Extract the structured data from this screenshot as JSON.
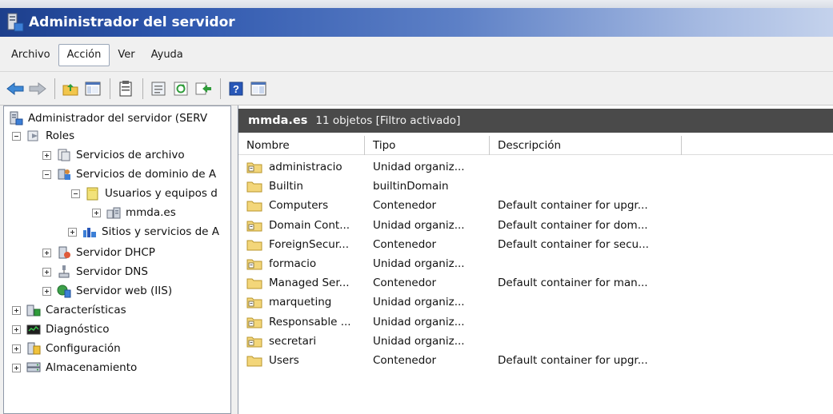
{
  "window": {
    "title": "Administrador del servidor"
  },
  "menu": {
    "items": [
      "Archivo",
      "Acción",
      "Ver",
      "Ayuda"
    ],
    "active_index": 1
  },
  "toolbar": {
    "buttons": [
      "back-icon",
      "forward-icon",
      "up-folder-icon",
      "show-tree-icon",
      "clipboard-icon",
      "properties-icon",
      "refresh-icon",
      "export-list-icon",
      "help-icon",
      "show-action-pane-icon"
    ]
  },
  "tree": [
    {
      "label": "Administrador del servidor (SERV",
      "level": 0,
      "expander": "none",
      "icon": "server-manager-icon"
    },
    {
      "label": "Roles",
      "level": 0,
      "expander": "minus",
      "icon": "roles-icon"
    },
    {
      "label": "Servicios de archivo",
      "level": 1,
      "expander": "plus",
      "icon": "file-services-icon"
    },
    {
      "label": "Servicios de dominio de A",
      "level": 1,
      "expander": "minus",
      "icon": "ad-ds-icon"
    },
    {
      "label": "Usuarios y equipos d",
      "level": 2,
      "expander": "minus",
      "icon": "users-computers-icon"
    },
    {
      "label": "mmda.es",
      "level": 3,
      "expander": "plus",
      "icon": "domain-icon",
      "selected": true
    },
    {
      "label": "Sitios y servicios de A",
      "level": 2,
      "expander": "plus",
      "icon": "sites-services-icon"
    },
    {
      "label": "Servidor DHCP",
      "level": 1,
      "expander": "plus",
      "icon": "dhcp-icon"
    },
    {
      "label": "Servidor DNS",
      "level": 1,
      "expander": "plus",
      "icon": "dns-icon"
    },
    {
      "label": "Servidor web (IIS)",
      "level": 1,
      "expander": "plus",
      "icon": "iis-icon"
    },
    {
      "label": "Características",
      "level": 0,
      "expander": "plus",
      "icon": "features-icon"
    },
    {
      "label": "Diagnóstico",
      "level": 0,
      "expander": "plus",
      "icon": "diagnostics-icon"
    },
    {
      "label": "Configuración",
      "level": 0,
      "expander": "plus",
      "icon": "configuration-icon"
    },
    {
      "label": "Almacenamiento",
      "level": 0,
      "expander": "plus",
      "icon": "storage-icon"
    }
  ],
  "list": {
    "title": "mmda.es",
    "info": "11 objetos  [Filtro activado]",
    "columns": [
      "Nombre",
      "Tipo",
      "Descripción"
    ],
    "rows": [
      {
        "name": "administracio",
        "type": "Unidad organiz...",
        "desc": "",
        "icon": "ou-folder-icon"
      },
      {
        "name": "Builtin",
        "type": "builtinDomain",
        "desc": "",
        "icon": "folder-icon"
      },
      {
        "name": "Computers",
        "type": "Contenedor",
        "desc": "Default container for upgr...",
        "icon": "folder-icon"
      },
      {
        "name": "Domain Cont...",
        "type": "Unidad organiz...",
        "desc": "Default container for dom...",
        "icon": "ou-folder-icon"
      },
      {
        "name": "ForeignSecur...",
        "type": "Contenedor",
        "desc": "Default container for secu...",
        "icon": "folder-icon"
      },
      {
        "name": "formacio",
        "type": "Unidad organiz...",
        "desc": "",
        "icon": "ou-folder-icon"
      },
      {
        "name": "Managed Ser...",
        "type": "Contenedor",
        "desc": "Default container for man...",
        "icon": "folder-icon"
      },
      {
        "name": "marqueting",
        "type": "Unidad organiz...",
        "desc": "",
        "icon": "ou-folder-icon"
      },
      {
        "name": "Responsable ...",
        "type": "Unidad organiz...",
        "desc": "",
        "icon": "ou-folder-icon"
      },
      {
        "name": "secretari",
        "type": "Unidad organiz...",
        "desc": "",
        "icon": "ou-folder-icon"
      },
      {
        "name": "Users",
        "type": "Contenedor",
        "desc": "Default container for upgr...",
        "icon": "folder-icon"
      }
    ]
  }
}
